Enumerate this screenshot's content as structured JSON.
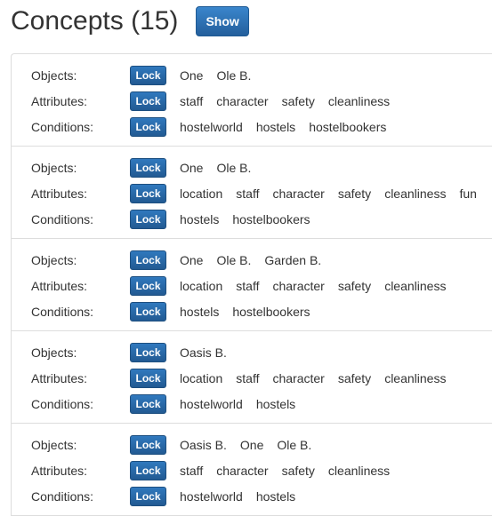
{
  "header": {
    "title": "Concepts (15)",
    "show_label": "Show"
  },
  "labels": {
    "objects": "Objects:",
    "attributes": "Attributes:",
    "conditions": "Conditions:",
    "lock": "Lock"
  },
  "concepts": [
    {
      "objects": [
        "One",
        "Ole B."
      ],
      "attributes": [
        "staff",
        "character",
        "safety",
        "cleanliness"
      ],
      "conditions": [
        "hostelworld",
        "hostels",
        "hostelbookers"
      ]
    },
    {
      "objects": [
        "One",
        "Ole B."
      ],
      "attributes": [
        "location",
        "staff",
        "character",
        "safety",
        "cleanliness",
        "fun"
      ],
      "conditions": [
        "hostels",
        "hostelbookers"
      ]
    },
    {
      "objects": [
        "One",
        "Ole B.",
        "Garden B."
      ],
      "attributes": [
        "location",
        "staff",
        "character",
        "safety",
        "cleanliness"
      ],
      "conditions": [
        "hostels",
        "hostelbookers"
      ]
    },
    {
      "objects": [
        "Oasis B."
      ],
      "attributes": [
        "location",
        "staff",
        "character",
        "safety",
        "cleanliness"
      ],
      "conditions": [
        "hostelworld",
        "hostels"
      ]
    },
    {
      "objects": [
        "Oasis B.",
        "One",
        "Ole B."
      ],
      "attributes": [
        "staff",
        "character",
        "safety",
        "cleanliness"
      ],
      "conditions": [
        "hostelworld",
        "hostels"
      ]
    }
  ]
}
